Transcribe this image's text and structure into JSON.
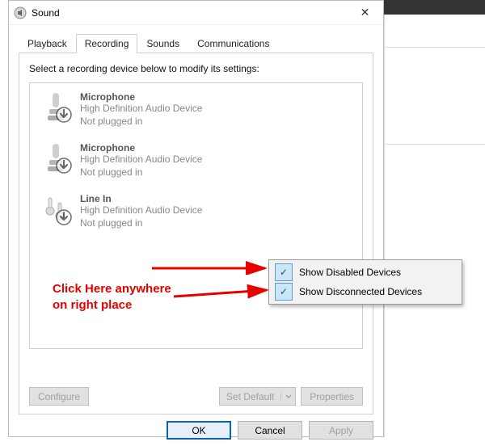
{
  "window": {
    "title": "Sound"
  },
  "tabs": {
    "playback": "Playback",
    "recording": "Recording",
    "sounds": "Sounds",
    "communications": "Communications"
  },
  "instruction": "Select a recording device below to modify its settings:",
  "devices": [
    {
      "name": "Microphone",
      "desc": "High Definition Audio Device",
      "status": "Not plugged in"
    },
    {
      "name": "Microphone",
      "desc": "High Definition Audio Device",
      "status": "Not plugged in"
    },
    {
      "name": "Line In",
      "desc": "High Definition Audio Device",
      "status": "Not plugged in"
    }
  ],
  "panelButtons": {
    "configure": "Configure",
    "setDefault": "Set Default",
    "properties": "Properties"
  },
  "bottomButtons": {
    "ok": "OK",
    "cancel": "Cancel",
    "apply": "Apply"
  },
  "contextMenu": {
    "showDisabled": "Show Disabled Devices",
    "showDisconnected": "Show Disconnected Devices"
  },
  "annotation": {
    "line1": "Click Here anywhere",
    "line2": "on right place"
  }
}
